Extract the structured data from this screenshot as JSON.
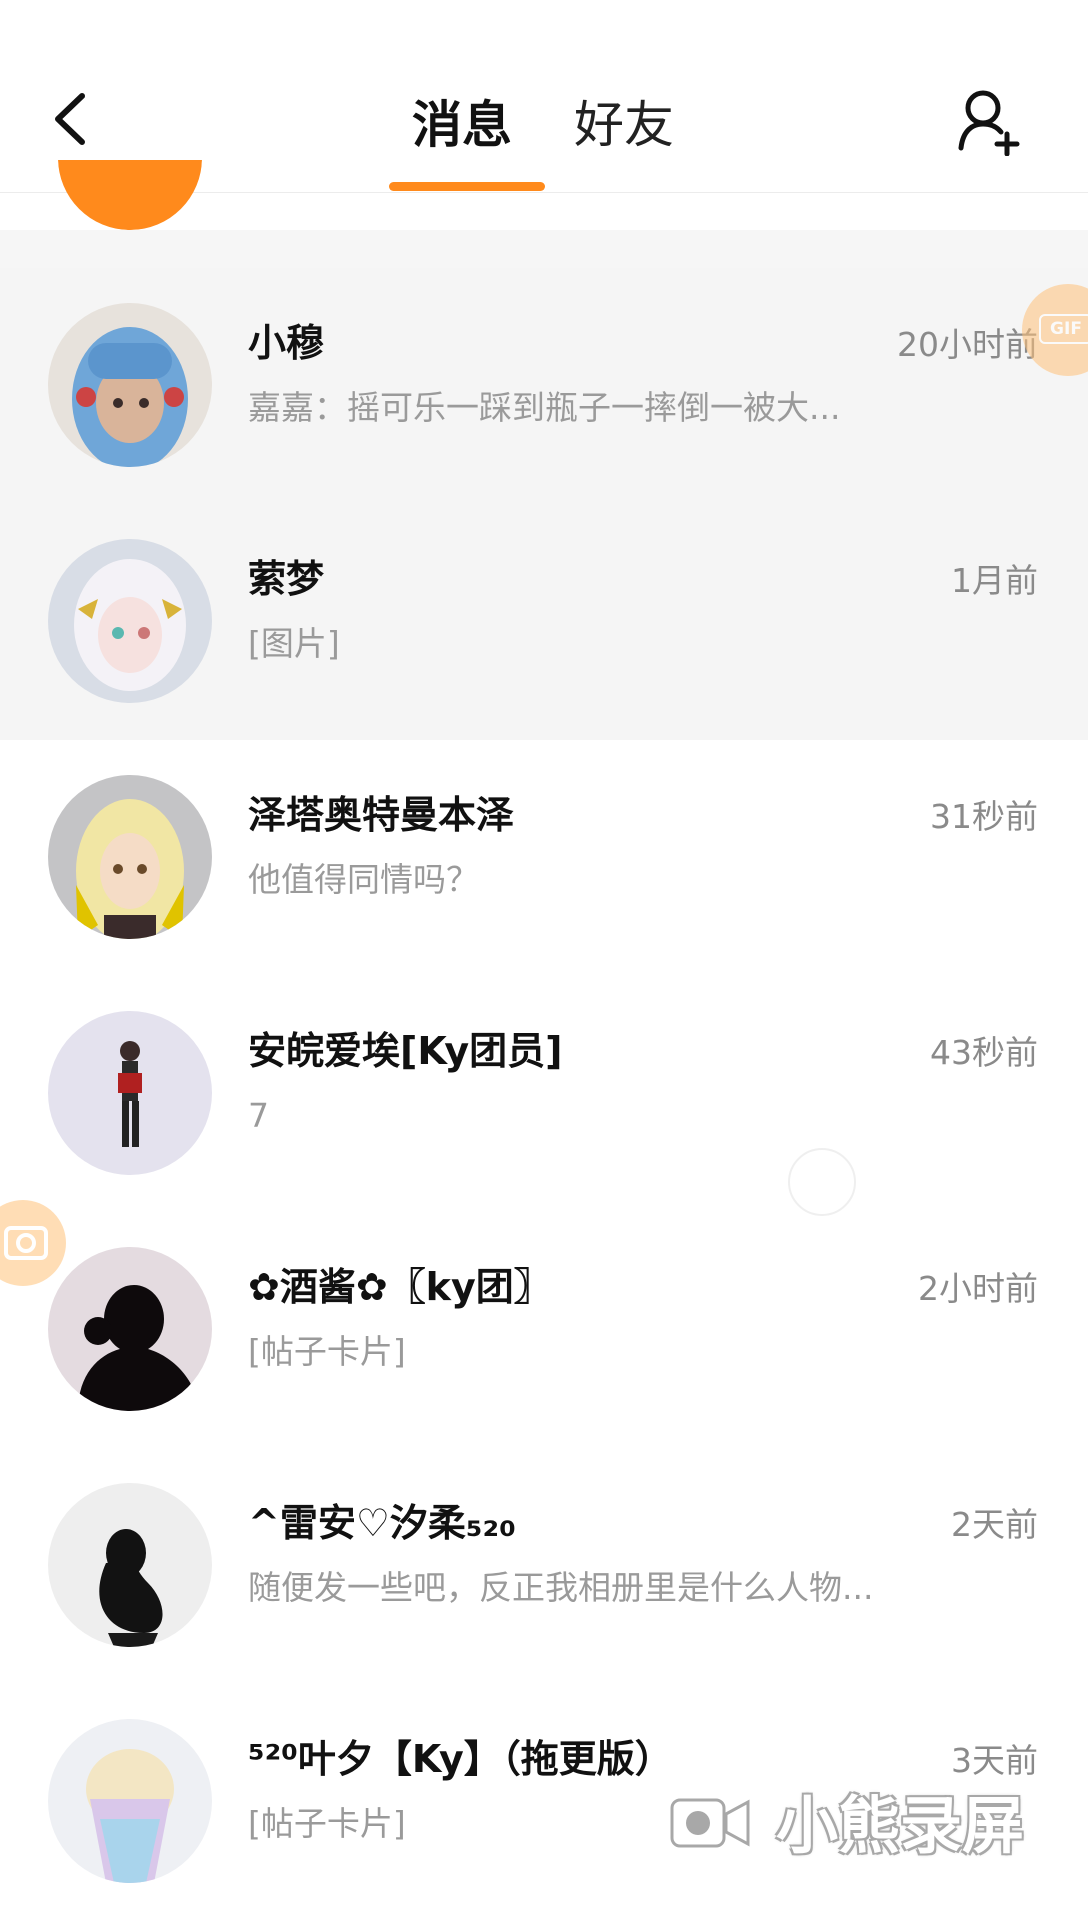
{
  "colors": {
    "accent": "#ff8a1c",
    "accent_light": "#ffc27a",
    "pinned_bg": "#f5f5f5",
    "time_text": "#8a8a8a",
    "preview_text": "#9a9a9a"
  },
  "header": {
    "back_icon": "chevron-left-icon",
    "add_friend_icon": "add-user-icon",
    "tabs": [
      {
        "label": "消息",
        "active": true
      },
      {
        "label": "好友",
        "active": false
      }
    ]
  },
  "conversations": [
    {
      "name": "小穆",
      "time": "20小时前",
      "preview": "嘉嘉：摇可乐一踩到瓶子一摔倒一被大...",
      "pinned": true
    },
    {
      "name": "萦梦",
      "time": "1月前",
      "preview": "[图片]",
      "pinned": true
    },
    {
      "name": "泽塔奥特曼本泽",
      "time": "31秒前",
      "preview": "他值得同情吗？",
      "pinned": false
    },
    {
      "name": "安皖爱埃[Ky团员]",
      "time": "43秒前",
      "preview": "7",
      "pinned": false
    },
    {
      "name": "✿酒酱✿〖ky团〗",
      "time": "2小时前",
      "preview": "[帖子卡片]",
      "pinned": false
    },
    {
      "name": "^雷安♡汐柔₅₂₀",
      "time": "2天前",
      "preview": "随便发一些吧，反正我相册里是什么人物...",
      "pinned": false
    },
    {
      "name": "⁵²⁰叶夕【Ky】（拖更版）",
      "time": "3天前",
      "preview": "[帖子卡片]",
      "pinned": false
    }
  ],
  "floating": {
    "gif_label": "GIF",
    "camera_icon": "camera-icon"
  },
  "watermark": {
    "icon": "video-camera-icon",
    "text": "小熊录屏"
  }
}
